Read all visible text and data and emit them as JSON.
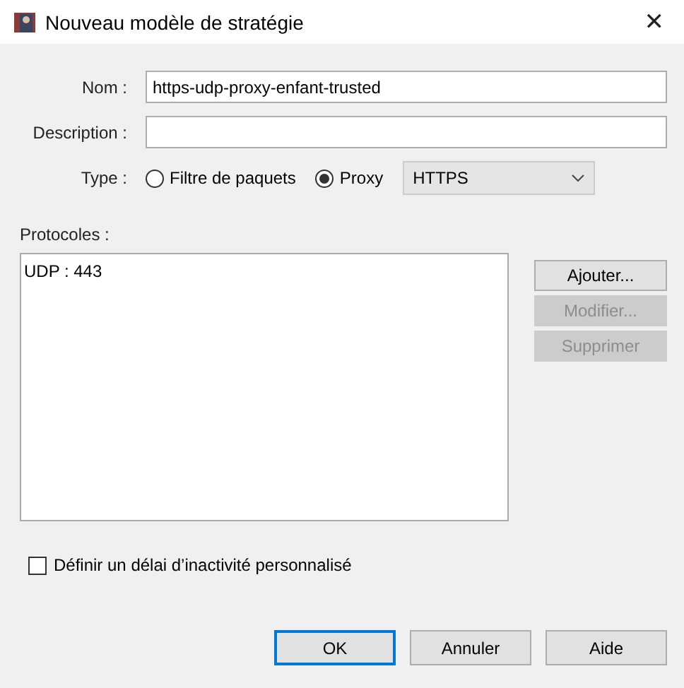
{
  "window": {
    "title": "Nouveau modèle de stratégie",
    "close": "✕"
  },
  "fields": [
    {
      "label": "Nom :",
      "value": "https-udp-proxy-enfant-trusted"
    },
    {
      "label": "Description :"
    }
  ],
  "type": {
    "label": "Type :",
    "options": [
      {
        "label": "Filtre de paquets",
        "selected": false
      },
      {
        "label": "Proxy",
        "selected": true
      }
    ],
    "select": {
      "value": "HTTPS",
      "disabled": false
    }
  },
  "protocols": {
    "label": "Protocoles :",
    "items": [
      "UDP : 443"
    ],
    "buttons": [
      {
        "label": "Ajouter...",
        "disabled": false
      },
      {
        "label": "Modifier...",
        "disabled": true
      },
      {
        "label": "Supprimer",
        "disabled": true
      }
    ]
  },
  "idle_timeout": {
    "label": "Définir un délai d’inactivité personnalisé",
    "checked": false
  },
  "buttons": [
    {
      "label": "OK",
      "default": true
    },
    {
      "label": "Annuler",
      "default": false
    },
    {
      "label": "Aide",
      "default": false
    }
  ]
}
